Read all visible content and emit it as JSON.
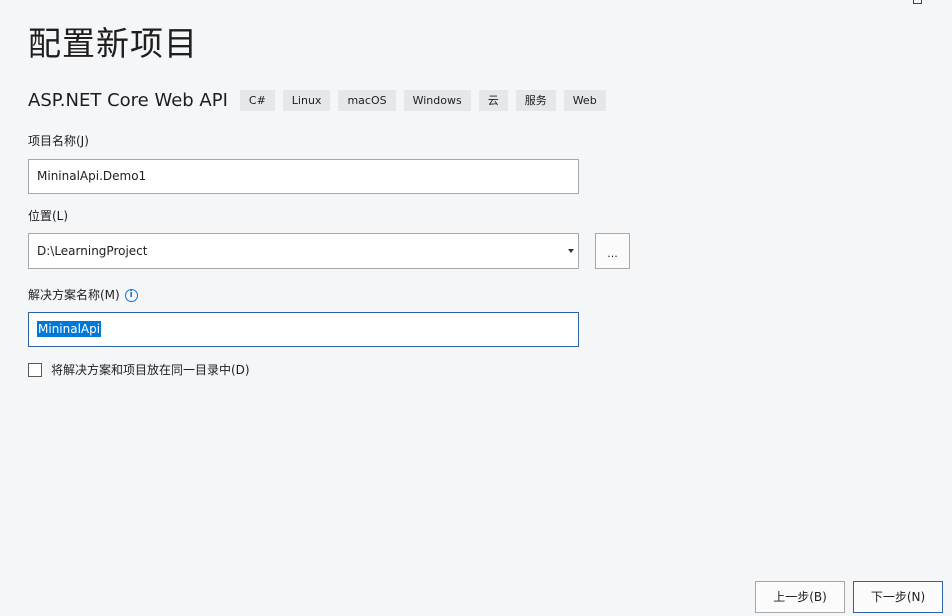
{
  "window": {
    "title": "配置新项目"
  },
  "template": {
    "name": "ASP.NET Core Web API",
    "tags": [
      "C#",
      "Linux",
      "macOS",
      "Windows",
      "云",
      "服务",
      "Web"
    ]
  },
  "project_name": {
    "label": "项目名称(J)",
    "value": "MininalApi.Demo1"
  },
  "location": {
    "label": "位置(L)",
    "value": "D:\\LearningProject",
    "browse_label": "..."
  },
  "solution_name": {
    "label": "解决方案名称(M)",
    "value": "MininalApi",
    "info_icon": "info-circle-icon"
  },
  "same_directory": {
    "label": "将解决方案和项目放在同一目录中(D)",
    "checked": false
  },
  "footer": {
    "back_label": "上一步(B)",
    "next_label": "下一步(N)"
  },
  "colors": {
    "background": "#f5f6f8",
    "accent": "#2b63a6",
    "selection": "#0078d7",
    "tag_background": "#e6e7ea"
  }
}
